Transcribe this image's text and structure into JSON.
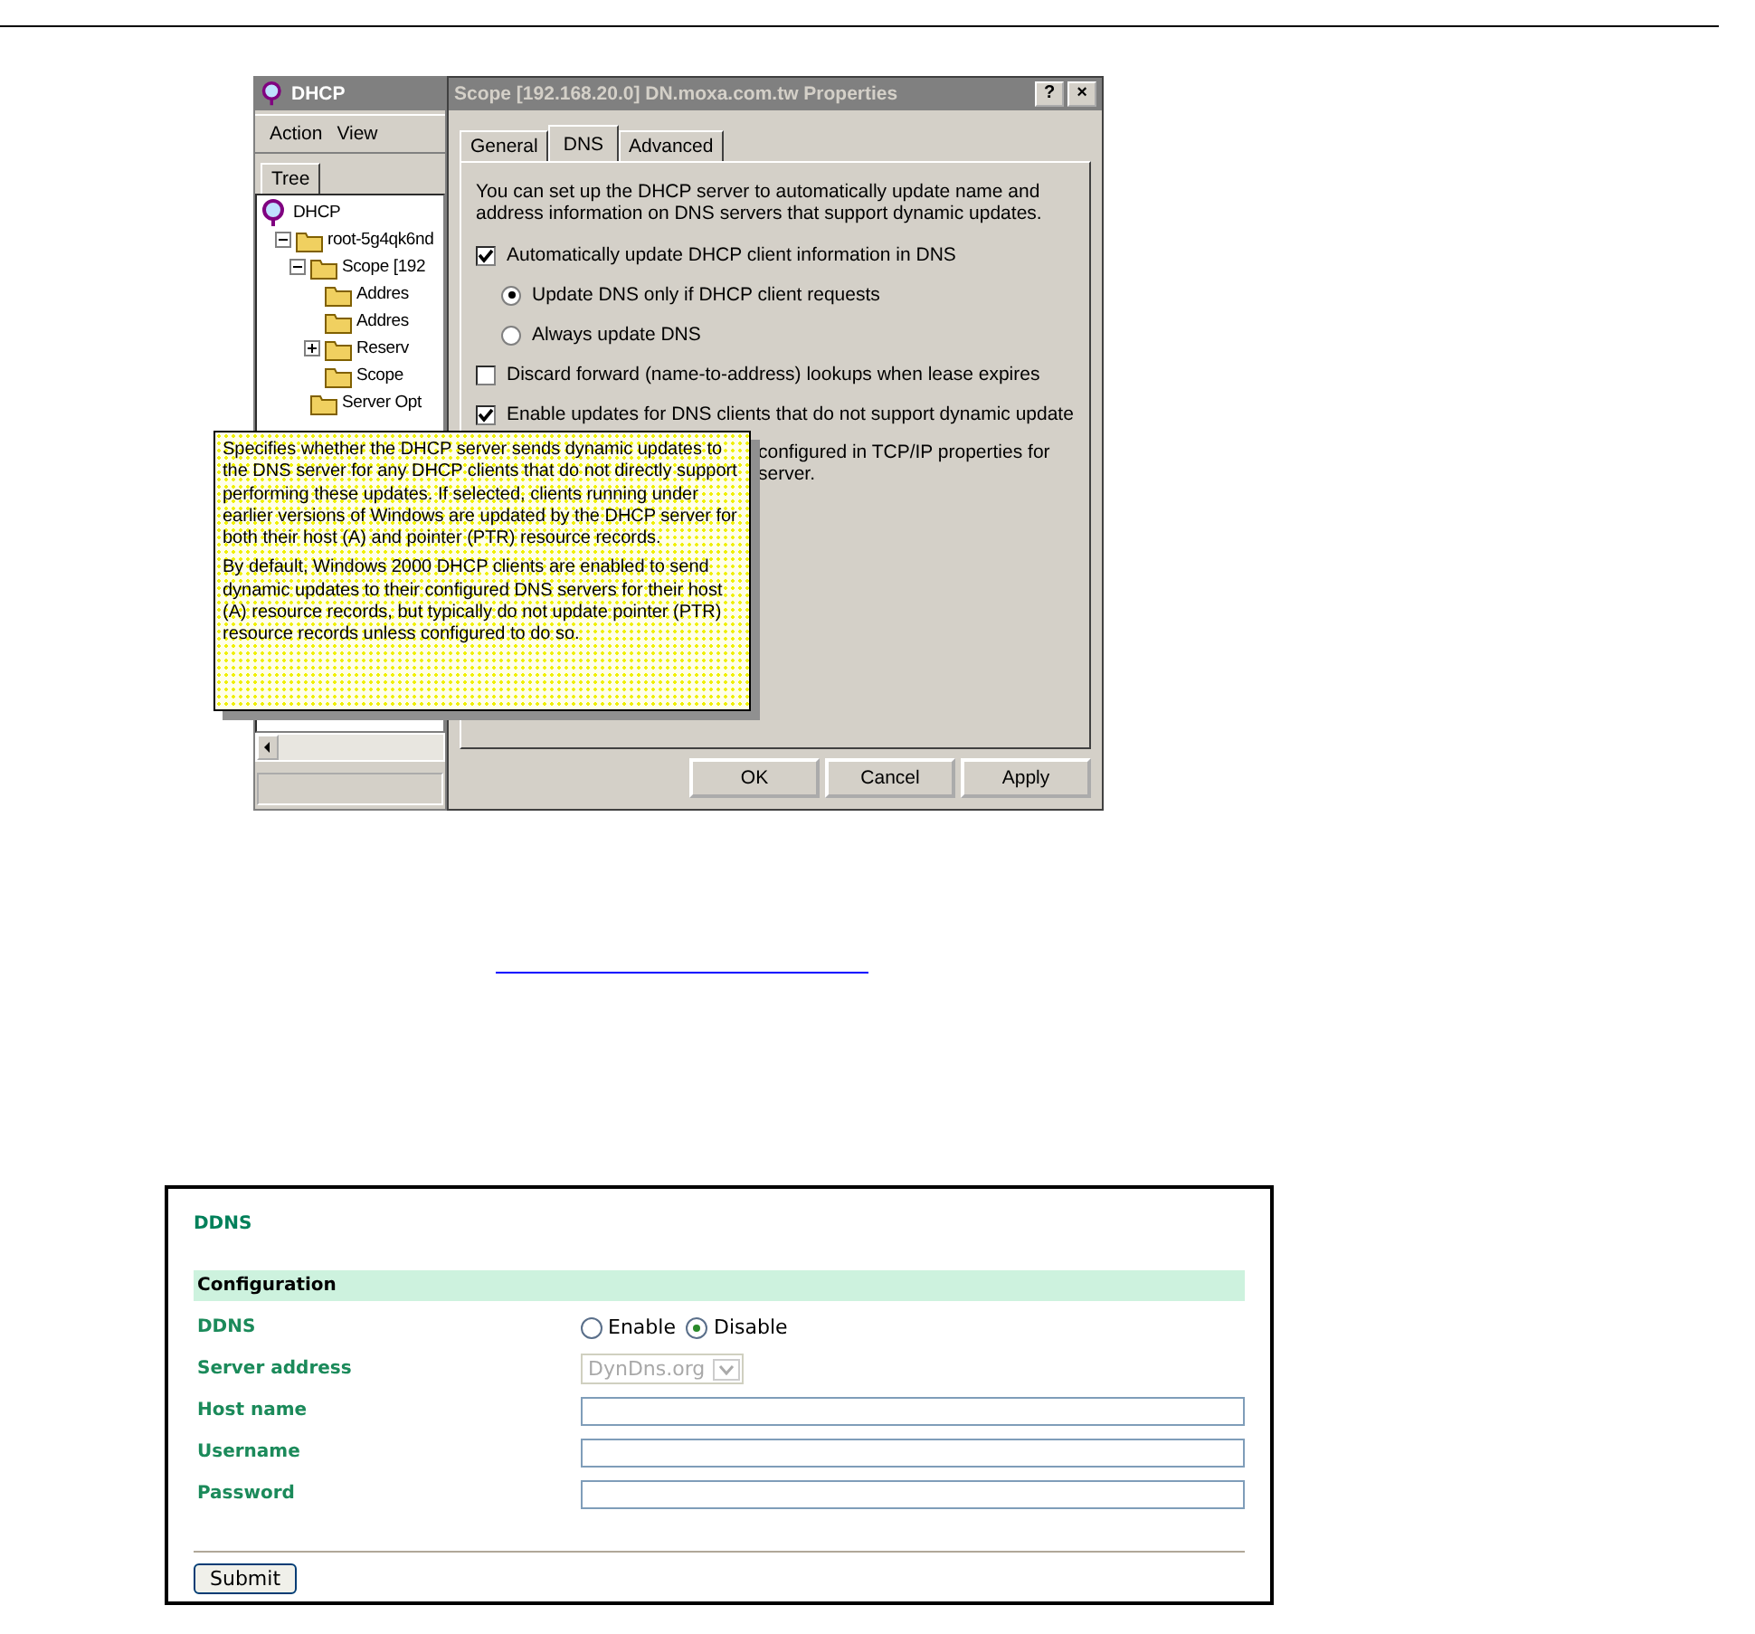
{
  "figure_1": {
    "mmc": {
      "title": "DHCP",
      "menu": [
        "Action",
        "View"
      ],
      "pane_tab": "Tree",
      "tree": [
        {
          "label": "DHCP",
          "children": [
            {
              "label": "root-5g4qk6nd",
              "expanded": true,
              "children": [
                {
                  "label": "Scope [192",
                  "expanded": true,
                  "children": [
                    {
                      "label": "Addres"
                    },
                    {
                      "label": "Addres"
                    },
                    {
                      "label": "Reserv",
                      "expanded": false
                    },
                    {
                      "label": "Scope"
                    }
                  ]
                },
                {
                  "label": "Server Opt"
                }
              ]
            }
          ]
        }
      ]
    },
    "dialog": {
      "title": "Scope [192.168.20.0] DN.moxa.com.tw Properties",
      "help": "?",
      "close": "×",
      "tabs": [
        {
          "label": "General",
          "selected": false
        },
        {
          "label": "DNS",
          "selected": true
        },
        {
          "label": "Advanced",
          "selected": false
        }
      ],
      "intro": "You can set up the DHCP server to automatically update name and address information on DNS servers that support dynamic updates.",
      "options": [
        {
          "kind": "checkbox",
          "label": "Automatically update DHCP client information in DNS",
          "checked": true
        },
        {
          "kind": "radio",
          "label": "Update DNS only if DHCP client requests",
          "checked": true
        },
        {
          "kind": "radio",
          "label": "Always update DNS",
          "checked": false
        },
        {
          "kind": "checkbox",
          "label": "Discard forward (name-to-address) lookups when lease expires",
          "checked": false
        },
        {
          "kind": "checkbox",
          "label": "Enable updates for DNS clients that do not support dynamic update",
          "checked": true
        }
      ],
      "partial_lines": [
        "configured in TCP/IP properties for",
        "server."
      ],
      "buttons": [
        "OK",
        "Cancel",
        "Apply"
      ]
    },
    "tooltip": [
      "Specifies whether the DHCP server sends dynamic updates to the DNS server for any DHCP clients that do not directly support performing these updates. If selected, clients running under earlier versions of Windows are updated by the DHCP server for both their host (A) and pointer (PTR) resource records.",
      "By default, Windows 2000 DHCP clients are enabled to send dynamic updates to their configured DNS servers for their host (A) resource records, but typically do not update pointer (PTR) resource records unless configured to do so."
    ]
  },
  "figure_2": {
    "title": "DDNS",
    "section": "Configuration",
    "rows": [
      {
        "kind": "radio",
        "label": "DDNS",
        "options": [
          {
            "label": "Enable",
            "selected": false
          },
          {
            "label": "Disable",
            "selected": true
          }
        ]
      },
      {
        "kind": "select",
        "label": "Server address",
        "value": "DynDns.org",
        "disabled": true
      },
      {
        "kind": "text",
        "label": "Host name"
      },
      {
        "kind": "text",
        "label": "Username"
      },
      {
        "kind": "text",
        "label": "Password"
      }
    ],
    "submit": "Submit"
  }
}
